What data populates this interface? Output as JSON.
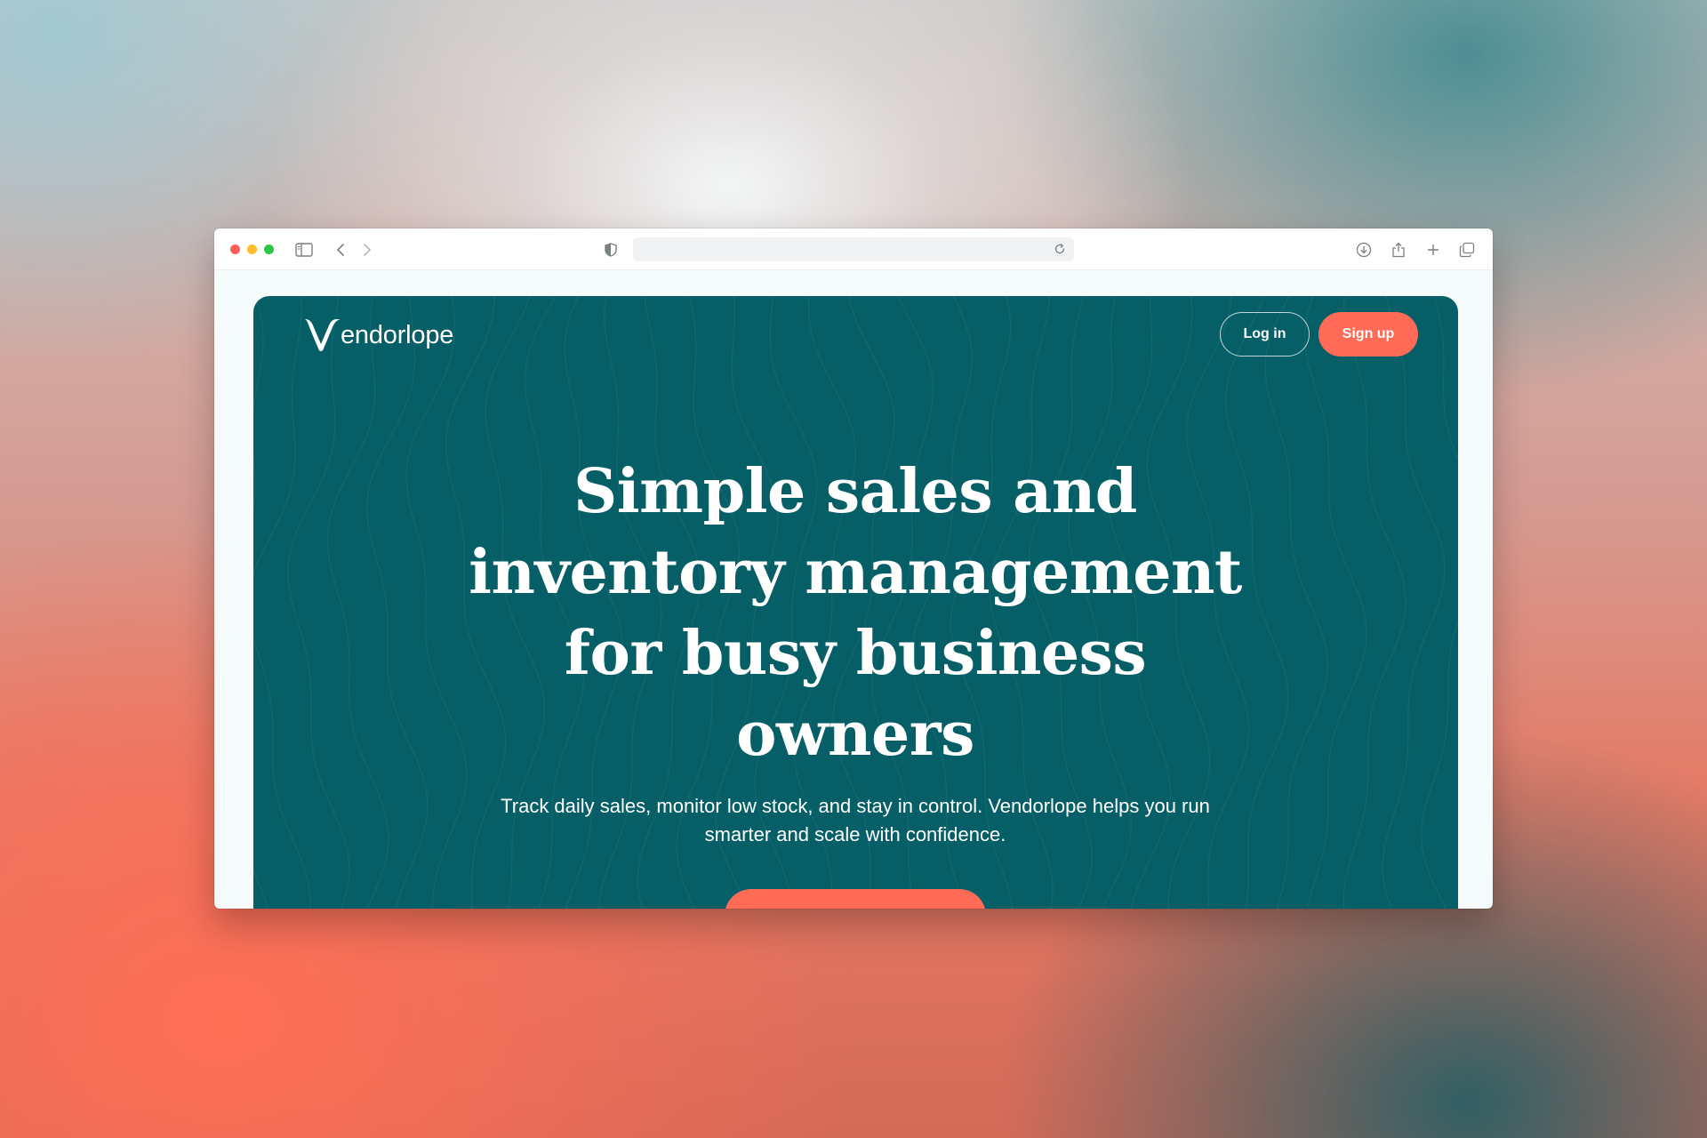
{
  "browser": {
    "address_text": "",
    "icons": [
      "sidebar-icon",
      "back-icon",
      "forward-icon",
      "shield-icon",
      "reload-icon",
      "download-icon",
      "share-icon",
      "new-tab-icon",
      "tabs-overview-icon"
    ]
  },
  "site": {
    "brand": "endorlope",
    "nav": {
      "login_label": "Log in",
      "signup_label": "Sign up"
    },
    "hero": {
      "headline_lines": [
        "Simple sales and",
        "inventory management",
        "for busy business",
        "owners"
      ],
      "subhead": "Track daily sales, monitor low stock, and stay in control. Vendorlope helps you run smarter and scale with confidence.",
      "cta_label": ""
    }
  },
  "colors": {
    "hero_bg": "#065f66",
    "accent": "#ff6b57",
    "text": "#ffffff"
  }
}
